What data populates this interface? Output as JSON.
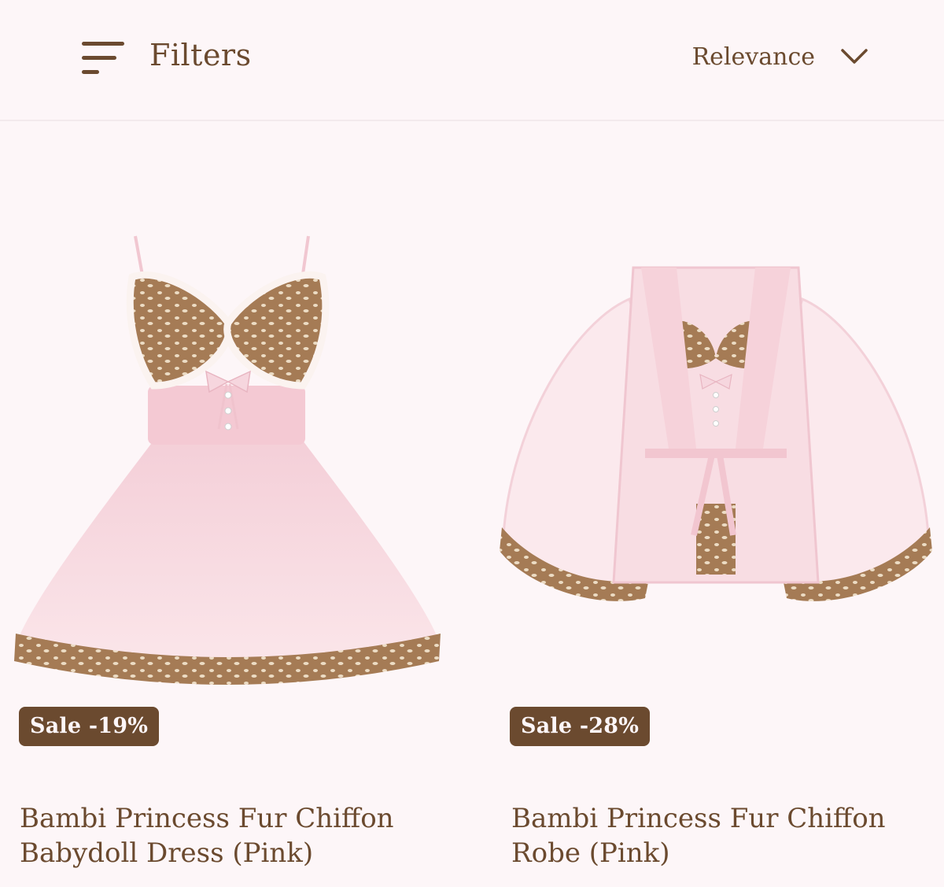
{
  "toolbar": {
    "filters_label": "Filters",
    "filters_icon": "menu-lines-icon",
    "sort_label": "Relevance",
    "sort_icon": "chevron-down-icon"
  },
  "products": [
    {
      "badge": "Sale -19%",
      "title_line1": "Bambi Princess Fur Chiffon",
      "title_line2": "Babydoll Dress (Pink)"
    },
    {
      "badge": "Sale -28%",
      "title_line1": "Bambi Princess Fur Chiffon",
      "title_line2": "Robe (Pink)"
    }
  ],
  "colors": {
    "background": "#fdf6f8",
    "brand_brown": "#6b4a2f",
    "badge_text": "#fdf6f8",
    "chiffon_pink": "#f7d8df",
    "fur_brown": "#a57b55",
    "fur_cream": "#ecdcc4"
  }
}
